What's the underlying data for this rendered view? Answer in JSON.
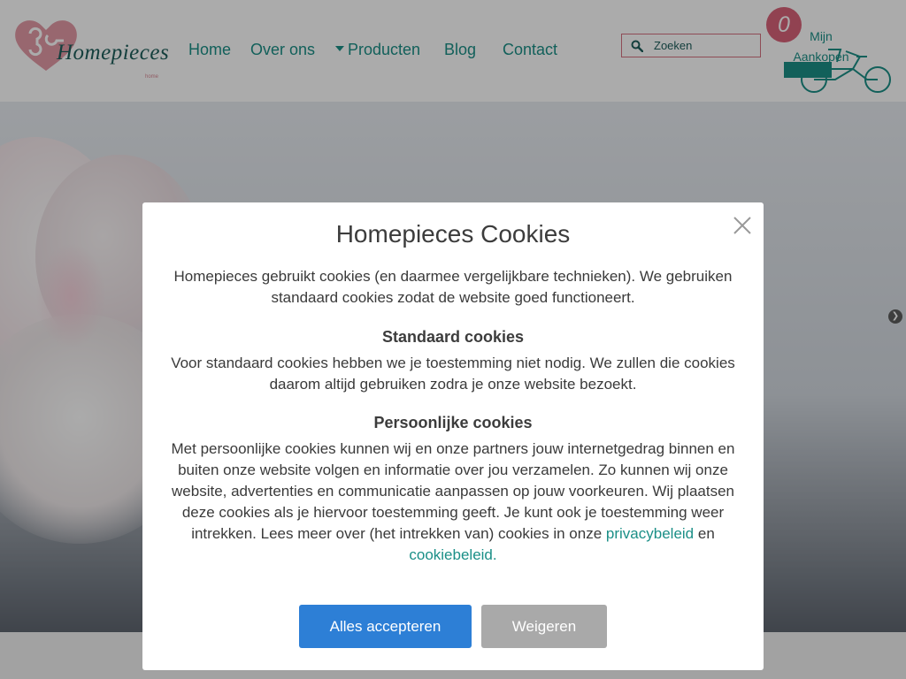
{
  "header": {
    "logo_text": "Homepieces",
    "logo_sub": "home",
    "nav": {
      "home": "Home",
      "about": "Over ons",
      "products": "Producten",
      "blog": "Blog",
      "contact": "Contact"
    },
    "search": {
      "placeholder": "Zoeken",
      "value": ""
    },
    "cart": {
      "count": "0",
      "label": "Mijn Aankopen"
    }
  },
  "modal": {
    "title": "Homepieces Cookies",
    "intro": "Homepieces gebruikt cookies (en daarmee vergelijkbare technieken). We gebruiken standaard cookies zodat de website goed functioneert.",
    "standard": {
      "heading": "Standaard cookies",
      "text": "Voor standaard cookies hebben we je toestemming niet nodig. We zullen die cookies daarom altijd gebruiken zodra je onze website bezoekt."
    },
    "personal": {
      "heading": "Persoonlijke cookies",
      "text": "Met persoonlijke cookies kunnen wij en onze partners jouw internetgedrag binnen en buiten onze website volgen en informatie over jou verzamelen. Zo kunnen wij onze website, advertenties en communicatie aanpassen op jouw voorkeuren. Wij plaatsen deze cookies als je hiervoor toestemming geeft. Je kunt ook je toestemming weer intrekken. Lees meer over (het intrekken van) cookies in onze",
      "privacy_link": "privacybeleid",
      "and": "en",
      "cookie_link": "cookiebeleid."
    },
    "accept_label": "Alles accepteren",
    "refuse_label": "Weigeren"
  },
  "colors": {
    "accent_teal": "#1b8f87",
    "brand_pink": "#d9637a",
    "accept_blue": "#2d7fd6",
    "refuse_grey": "#a9a9a9"
  },
  "icons": [
    "heart-puzzle-logo",
    "search-icon",
    "close-icon",
    "cargo-bike-icon",
    "chevron-right-icon"
  ]
}
